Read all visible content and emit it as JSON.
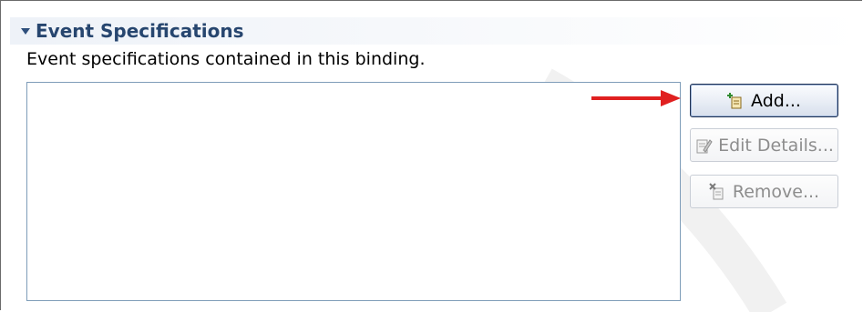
{
  "section": {
    "title": "Event Specifications",
    "description": "Event specifications contained in this binding."
  },
  "buttons": {
    "add_label": "Add...",
    "edit_label": "Edit Details...",
    "remove_label": "Remove..."
  },
  "list": {
    "items": []
  },
  "icons": {
    "twistie": "chevron-down-icon",
    "add": "add-document-icon",
    "edit": "edit-document-icon",
    "remove": "remove-document-icon",
    "arrow": "arrow-right-icon"
  },
  "colors": {
    "section_title": "#27466f",
    "list_border": "#7f9db9",
    "arrow": "#e02020",
    "disabled_text": "#8d8d8d"
  }
}
